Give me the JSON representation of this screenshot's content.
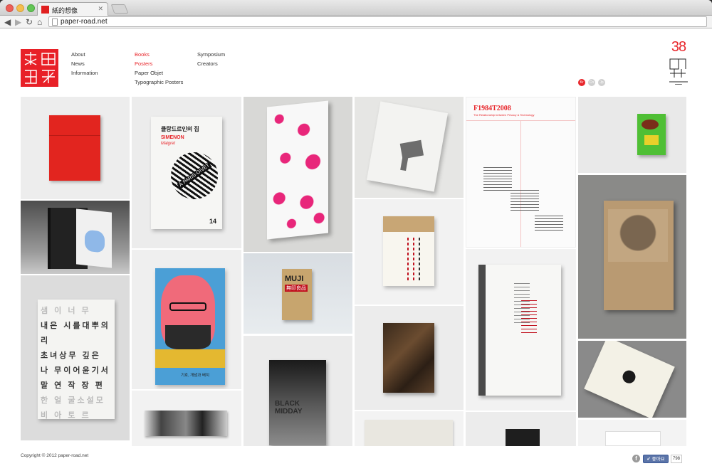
{
  "browser": {
    "tab_title": "紙的想像",
    "tab_close": "✕",
    "url": "paper-road.net",
    "back_glyph": "◀",
    "forward_glyph": "▶",
    "reload_glyph": "↻",
    "home_glyph": "⌂"
  },
  "nav": {
    "col1": [
      "About",
      "News",
      "Information"
    ],
    "col2": [
      "Books",
      "Posters",
      "Paper Objet",
      "Typographic Posters"
    ],
    "col3": [
      "Symposium",
      "Creators"
    ]
  },
  "brand": {
    "number": "38"
  },
  "languages": [
    "Kr",
    "Cn",
    "Jp"
  ],
  "tiles": {
    "simenon_title": "클랑드르인의 집",
    "simenon_author": "SIMENON",
    "simenon_cursive": "Maigret",
    "simenon_ball": "À PARIS-GIVET",
    "simenon_num": "14",
    "muji": "MUJI",
    "muji_sub": "無印良品",
    "black_midday": "BLACK MIDDAY",
    "f1984_title": "F1984T2008",
    "f1984_sub": "The Relationship between Privacy & Technology",
    "eco_caption": "기호, 개념과 배치",
    "korean_rows": [
      "샘 이 너 무",
      "내은 시를대뿌의리",
      "초녀상무 깊은",
      "나 무이어윤기서",
      "말 연 작 장 편",
      "한 얼 굴소설모",
      "비 아 토 르"
    ]
  },
  "footer": {
    "copyright": "Copyright © 2012 paper-road.net",
    "fb_glyph": "f",
    "like_label": "✔ 좋아요",
    "like_count": "798"
  },
  "colors": {
    "brand_red": "#e8262b",
    "tile_bg": "#e9e9e9"
  }
}
